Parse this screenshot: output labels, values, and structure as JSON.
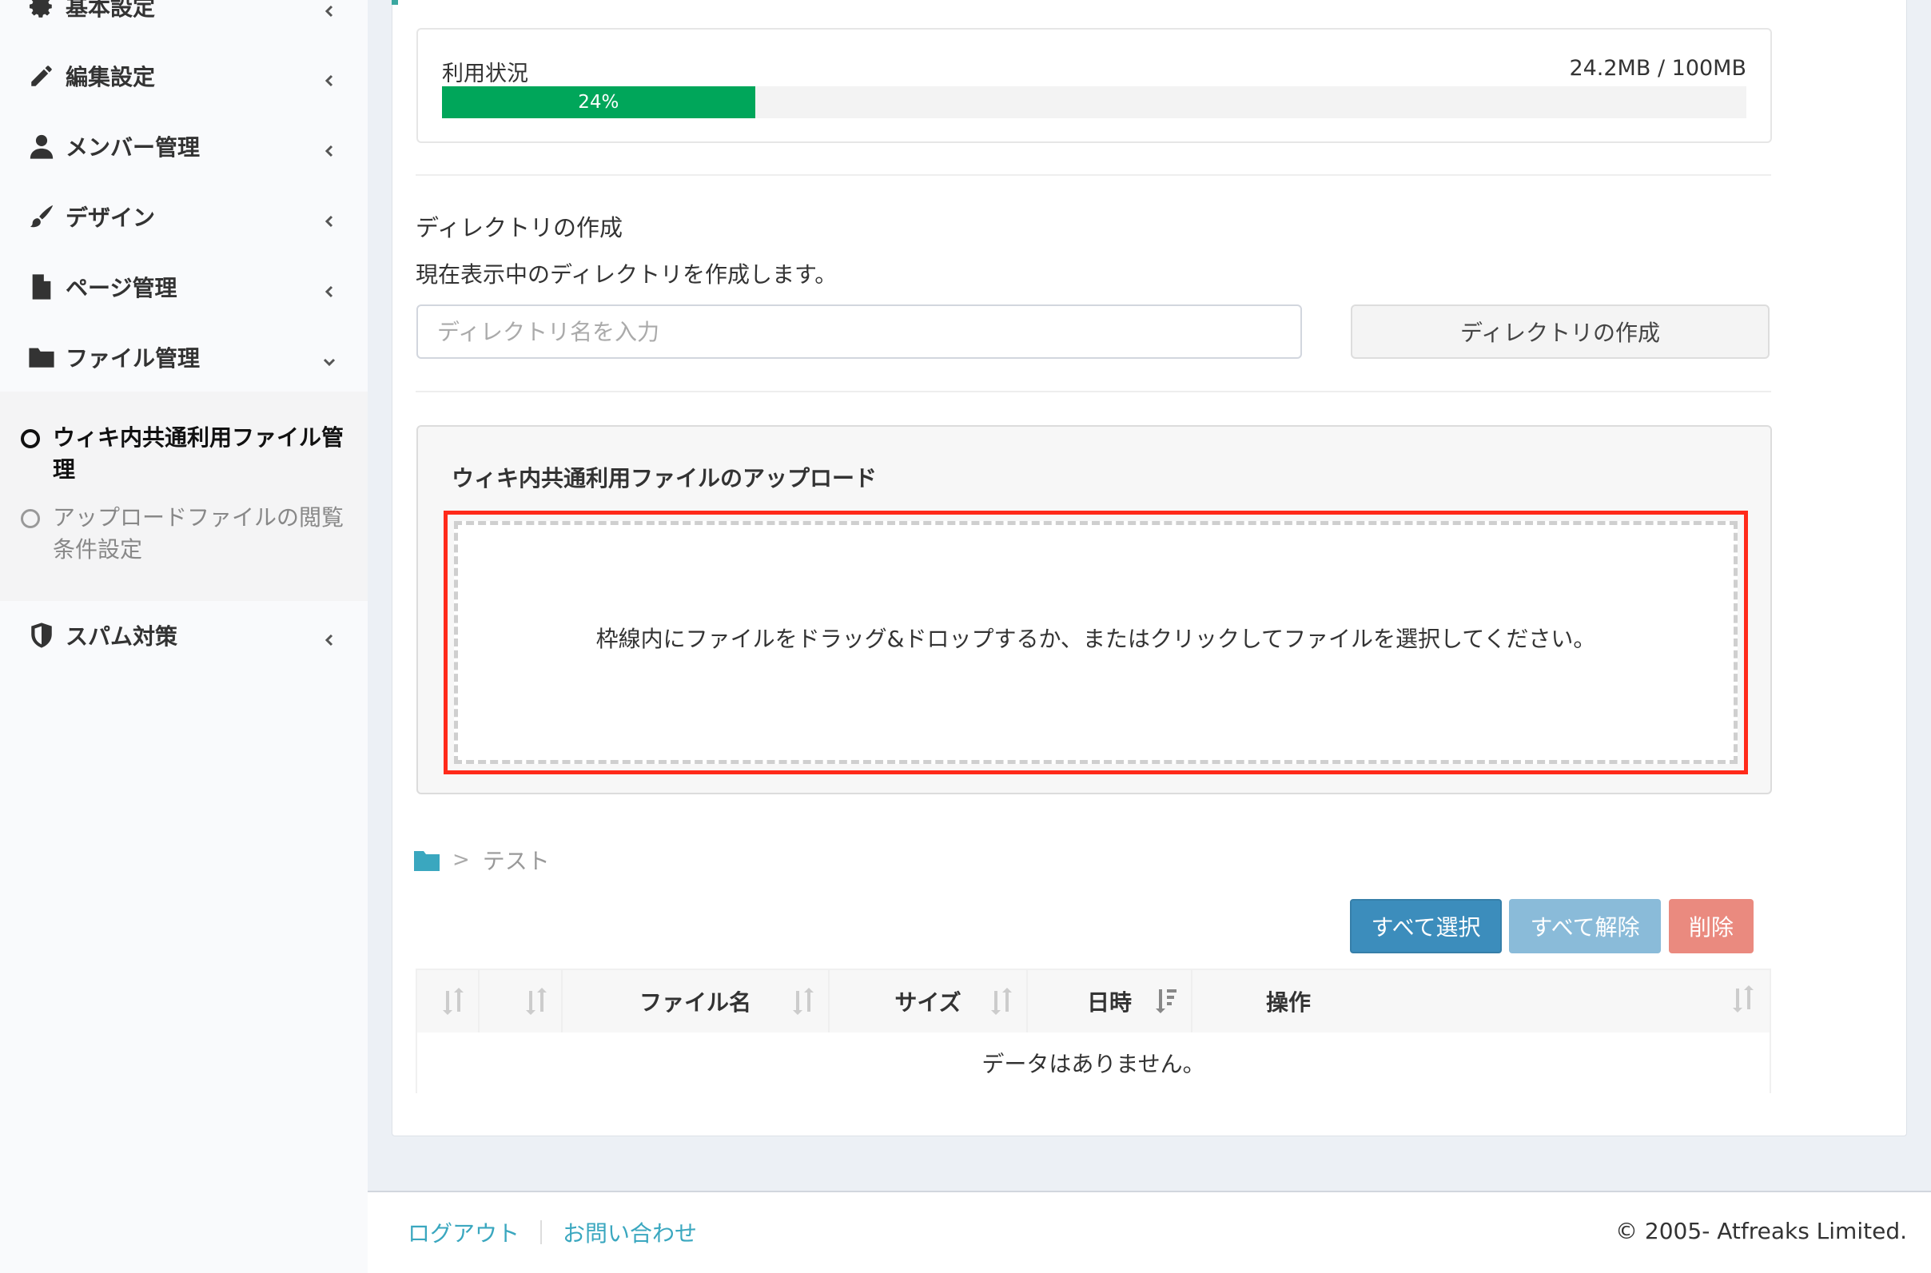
{
  "sidebar": {
    "items": [
      {
        "label": "基本設定",
        "icon": "gear-icon"
      },
      {
        "label": "編集設定",
        "icon": "pencil-icon"
      },
      {
        "label": "メンバー管理",
        "icon": "user-icon"
      },
      {
        "label": "デザイン",
        "icon": "brush-icon"
      },
      {
        "label": "ページ管理",
        "icon": "file-icon"
      },
      {
        "label": "ファイル管理",
        "icon": "folder-icon"
      },
      {
        "label": "スパム対策",
        "icon": "shield-icon"
      }
    ],
    "submenu": [
      {
        "label_line1": "ウィキ内共通利用ファイル管",
        "label_line2": "理",
        "active": true
      },
      {
        "label_line1": "アップロードファイルの閲覧",
        "label_line2": "条件設定",
        "active": false
      }
    ]
  },
  "usage": {
    "label": "利用状況",
    "size": "24.2MB / 100MB",
    "percent_text": "24%",
    "percent": 24
  },
  "directory": {
    "heading": "ディレクトリの作成",
    "description": "現在表示中のディレクトリを作成します。",
    "input_placeholder": "ディレクトリ名を入力",
    "button_label": "ディレクトリの作成"
  },
  "upload": {
    "title": "ウィキ内共通利用ファイルのアップロード",
    "dropzone_text": "枠線内にファイルをドラッグ&ドロップするか、またはクリックしてファイルを選択してください。"
  },
  "breadcrumb": {
    "separator": ">",
    "current": "テスト"
  },
  "actions": {
    "select_all": "すべて選択",
    "deselect_all": "すべて解除",
    "delete": "削除"
  },
  "table": {
    "headers": [
      "",
      "",
      "ファイル名",
      "サイズ",
      "日時",
      "操作"
    ],
    "empty_text": "データはありません。"
  },
  "footer": {
    "logout": "ログアウト",
    "contact": "お問い合わせ",
    "copyright": "© 2005- Atfreaks Limited."
  },
  "colors": {
    "progress": "#00a65a",
    "primary": "#3c8dbc",
    "danger": "#ea8a7f",
    "link": "#3aa7bf",
    "highlight": "#ff2a1a"
  }
}
